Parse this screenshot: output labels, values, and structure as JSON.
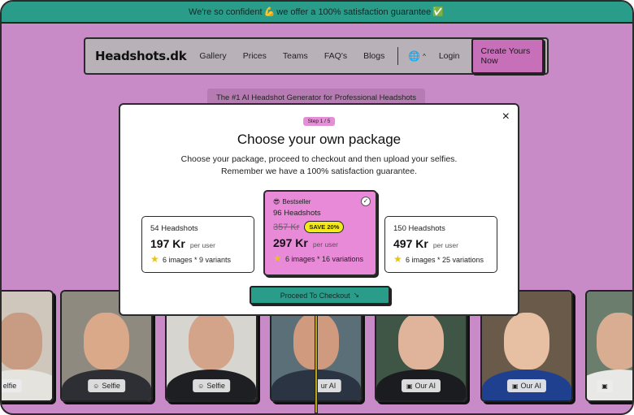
{
  "banner": {
    "text_before": "We're so confident",
    "emoji_muscle": "💪",
    "text_after": "we offer a 100% satisfaction guarantee",
    "emoji_check": "✅"
  },
  "nav": {
    "logo": "Headshots.dk",
    "links": [
      "Gallery",
      "Prices",
      "Teams",
      "FAQ's",
      "Blogs"
    ],
    "globe_icon": "🌐",
    "chevron": "^",
    "login": "Login",
    "cta": "Create Yours Now"
  },
  "hero": {
    "subtitle": "The #1 AI Headshot Generator for Professional Headshots"
  },
  "modal": {
    "close": "×",
    "step": "Step 1 / 5",
    "title": "Choose your own package",
    "description": "Choose your package, proceed to checkout and then upload your selfies. Remember we have a 100% satisfaction guarantee.",
    "packages": [
      {
        "name": "54 Headshots",
        "price": "197 Kr",
        "per": "per user",
        "feature": "6 images * 9 variants"
      },
      {
        "badge_emoji": "😎",
        "badge": "Bestseller",
        "name": "96 Headshots",
        "old_price": "357 Kr",
        "save": "SAVE 20%",
        "price": "297 Kr",
        "per": "per user",
        "feature": "6 images * 16 variations",
        "selected_mark": "✓"
      },
      {
        "name": "150 Headshots",
        "price": "497 Kr",
        "per": "per user",
        "feature": "6 images * 25 variations"
      }
    ],
    "proceed": "Proceed To Checkout",
    "proceed_arrow": "↘"
  },
  "photos": [
    {
      "label": "elfie",
      "icon": "☺"
    },
    {
      "label": "Selfie",
      "icon": "☺"
    },
    {
      "label": "Selfie",
      "icon": "☺"
    },
    {
      "label": "ur AI",
      "icon": "▣"
    },
    {
      "label": "Our AI",
      "icon": "▣"
    },
    {
      "label": "Our AI",
      "icon": "▣"
    },
    {
      "label": "",
      "icon": "▣"
    }
  ],
  "star_glyph": "★",
  "colors": {
    "page_bg": "#c98bc7",
    "banner": "#2a9d8a",
    "accent_pink": "#e88ad8",
    "cta_pink": "#c76fb9",
    "save_yellow": "#f3ea1c",
    "star_yellow": "#e3c51b"
  }
}
